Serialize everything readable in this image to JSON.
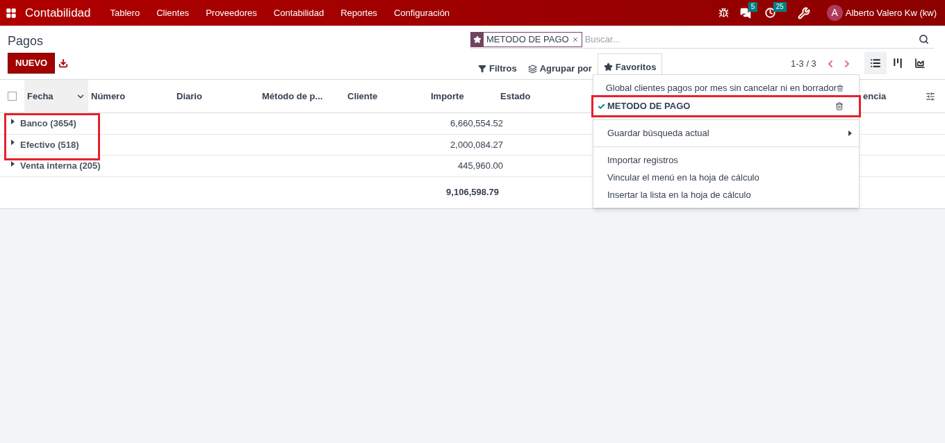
{
  "navbar": {
    "app": "Contabilidad",
    "menus": [
      "Tablero",
      "Clientes",
      "Proveedores",
      "Contabilidad",
      "Reportes",
      "Configuración"
    ],
    "messages_count": "5",
    "activities_count": "25",
    "user_initial": "A",
    "user_name": "Alberto Valero Kw (kw)"
  },
  "breadcrumb": "Pagos",
  "new_button": "NUEVO",
  "search": {
    "facet": "METODO DE PAGO",
    "placeholder": "Buscar..."
  },
  "filters": [
    {
      "label": "Filtros",
      "kind": "filter",
      "selected": false
    },
    {
      "label": "Agrupar por",
      "kind": "group",
      "selected": false
    },
    {
      "label": "Favoritos",
      "kind": "star",
      "selected": true
    }
  ],
  "pager": "1-3 / 3",
  "views": [
    {
      "kind": "list",
      "selected": true
    },
    {
      "kind": "kanban",
      "selected": false
    },
    {
      "kind": "graph",
      "selected": false
    }
  ],
  "table": {
    "all_checked": false,
    "columns": [
      "Fecha",
      "Número",
      "Diario",
      "Método de p...",
      "Cliente",
      "Importe",
      "Estado",
      "encia"
    ],
    "groups": [
      {
        "label": "Banco (3654)",
        "amount": "6,660,554.52"
      },
      {
        "label": "Efectivo (518)",
        "amount": "2,000,084.27"
      },
      {
        "label": "Venta interna (205)",
        "amount": "445,960.00"
      }
    ],
    "total": "9,106,598.79"
  },
  "favorites_menu": {
    "favorites": [
      {
        "label": "Global clientes pagos por mes sin cancelar ni en borrador",
        "selected": false,
        "highlighted": false
      },
      {
        "label": "METODO DE PAGO",
        "selected": true,
        "highlighted": true
      }
    ],
    "save": "Guardar búsqueda actual",
    "actions": [
      "Importar registros",
      "Vincular el menú en la hoja de cálculo",
      "Insertar la lista en la hoja de cálculo"
    ]
  }
}
